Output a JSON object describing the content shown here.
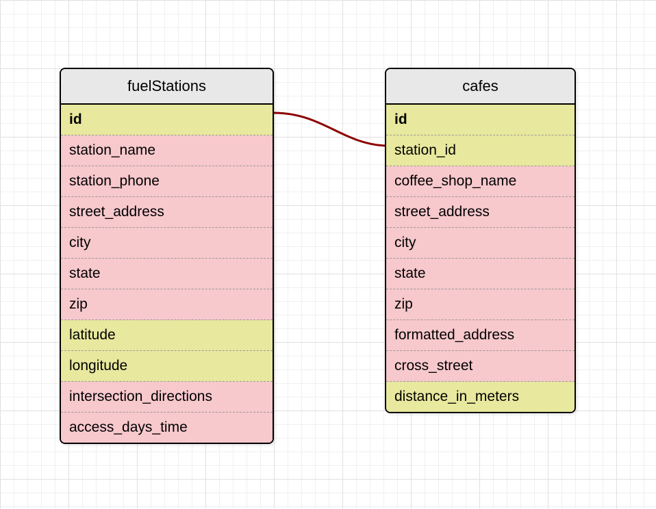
{
  "table1": {
    "name": "fuelStations",
    "fields": [
      {
        "name": "id",
        "type": "key"
      },
      {
        "name": "station_name",
        "type": "normal"
      },
      {
        "name": "station_phone",
        "type": "normal"
      },
      {
        "name": "street_address",
        "type": "normal"
      },
      {
        "name": "city",
        "type": "normal"
      },
      {
        "name": "state",
        "type": "normal"
      },
      {
        "name": "zip",
        "type": "normal"
      },
      {
        "name": "latitude",
        "type": "highlight"
      },
      {
        "name": "longitude",
        "type": "highlight"
      },
      {
        "name": "intersection_directions",
        "type": "normal"
      },
      {
        "name": "access_days_time",
        "type": "normal"
      }
    ]
  },
  "table2": {
    "name": "cafes",
    "fields": [
      {
        "name": "id",
        "type": "key"
      },
      {
        "name": "station_id",
        "type": "highlight"
      },
      {
        "name": "coffee_shop_name",
        "type": "normal"
      },
      {
        "name": "street_address",
        "type": "normal"
      },
      {
        "name": "city",
        "type": "normal"
      },
      {
        "name": "state",
        "type": "normal"
      },
      {
        "name": "zip",
        "type": "normal"
      },
      {
        "name": "formatted_address",
        "type": "normal"
      },
      {
        "name": "cross_street",
        "type": "normal"
      },
      {
        "name": "distance_in_meters",
        "type": "highlight"
      }
    ]
  },
  "connector": {
    "color": "#8B0000"
  }
}
